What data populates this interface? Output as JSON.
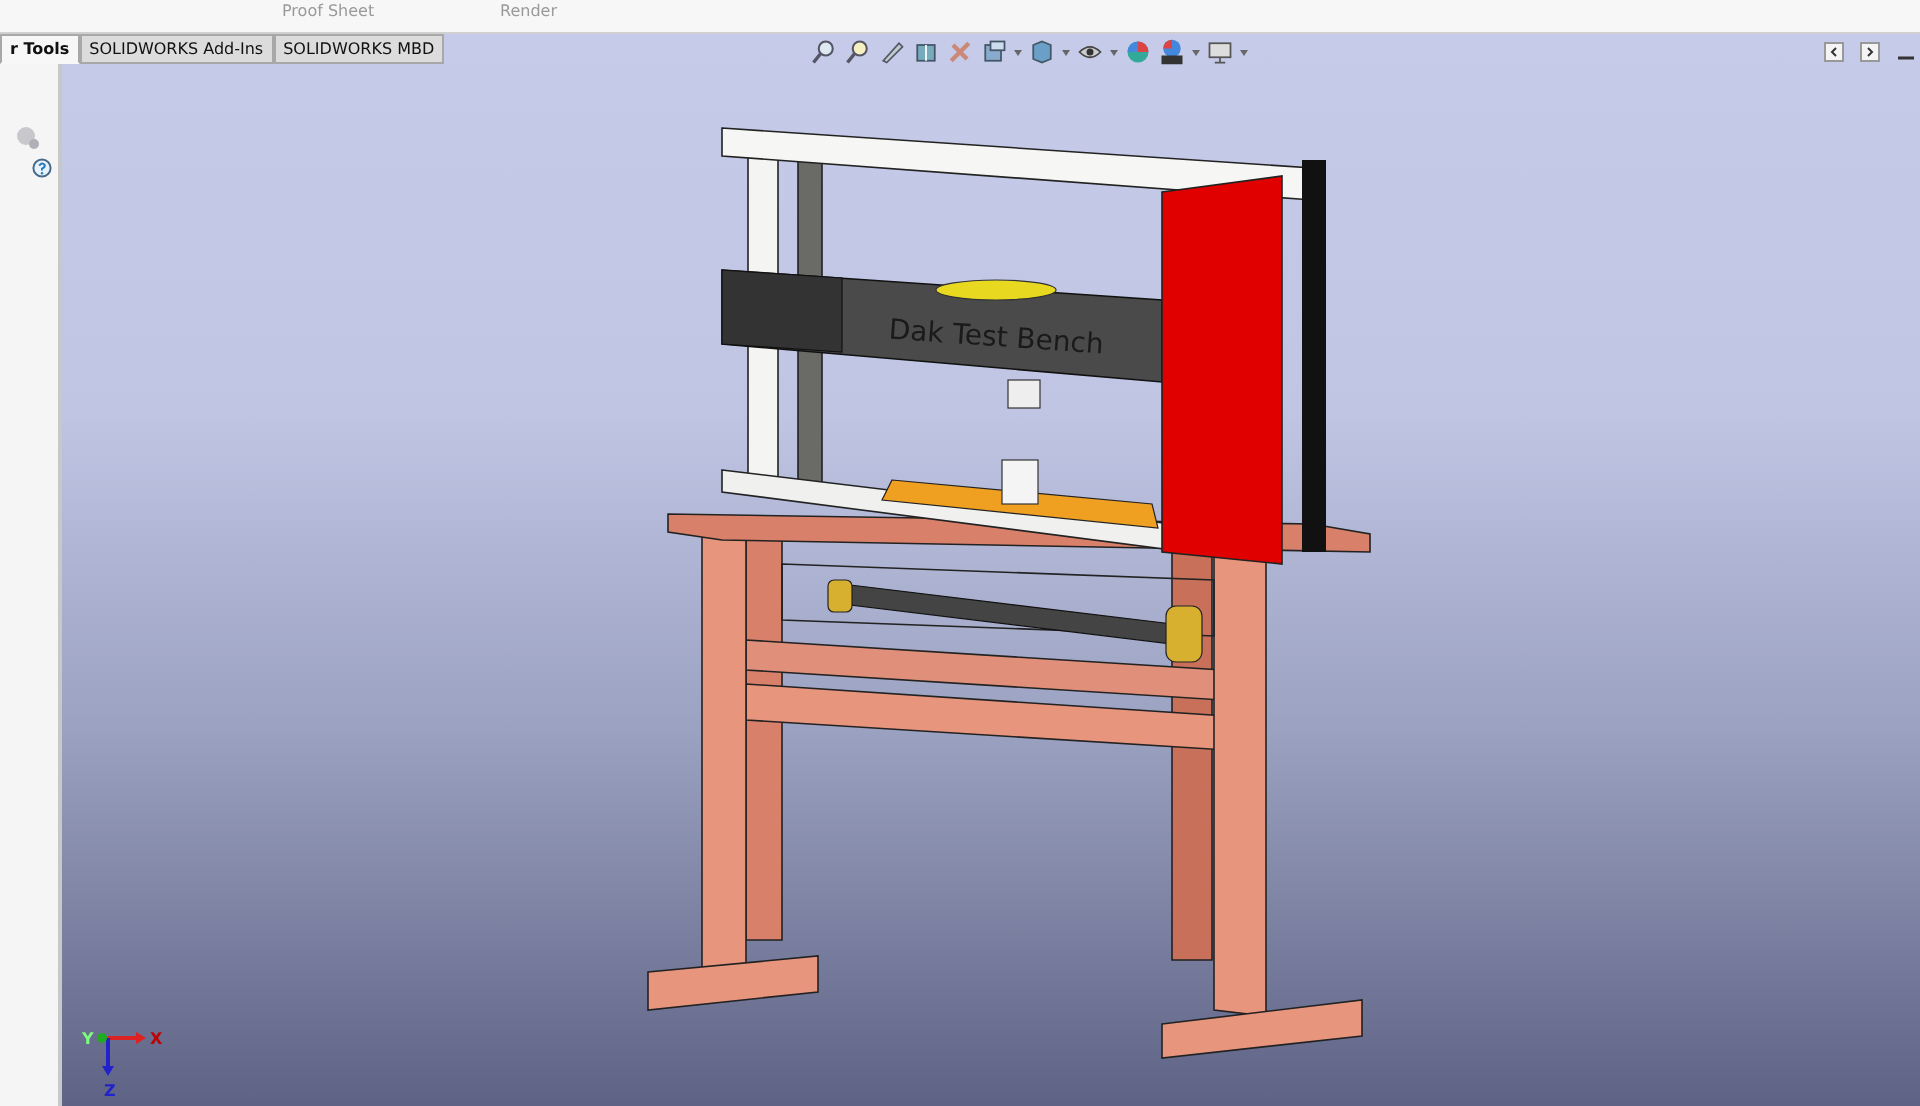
{
  "ribbon": {
    "labels": [
      "Proof Sheet",
      "Render"
    ]
  },
  "tabs": [
    {
      "label": "r Tools",
      "selected": true
    },
    {
      "label": "SOLIDWORKS Add-Ins",
      "selected": false
    },
    {
      "label": "SOLIDWORKS MBD",
      "selected": false
    }
  ],
  "model": {
    "engraving": "Dak Test Bench"
  },
  "triad": {
    "axes": [
      "X",
      "Y",
      "Z"
    ]
  }
}
